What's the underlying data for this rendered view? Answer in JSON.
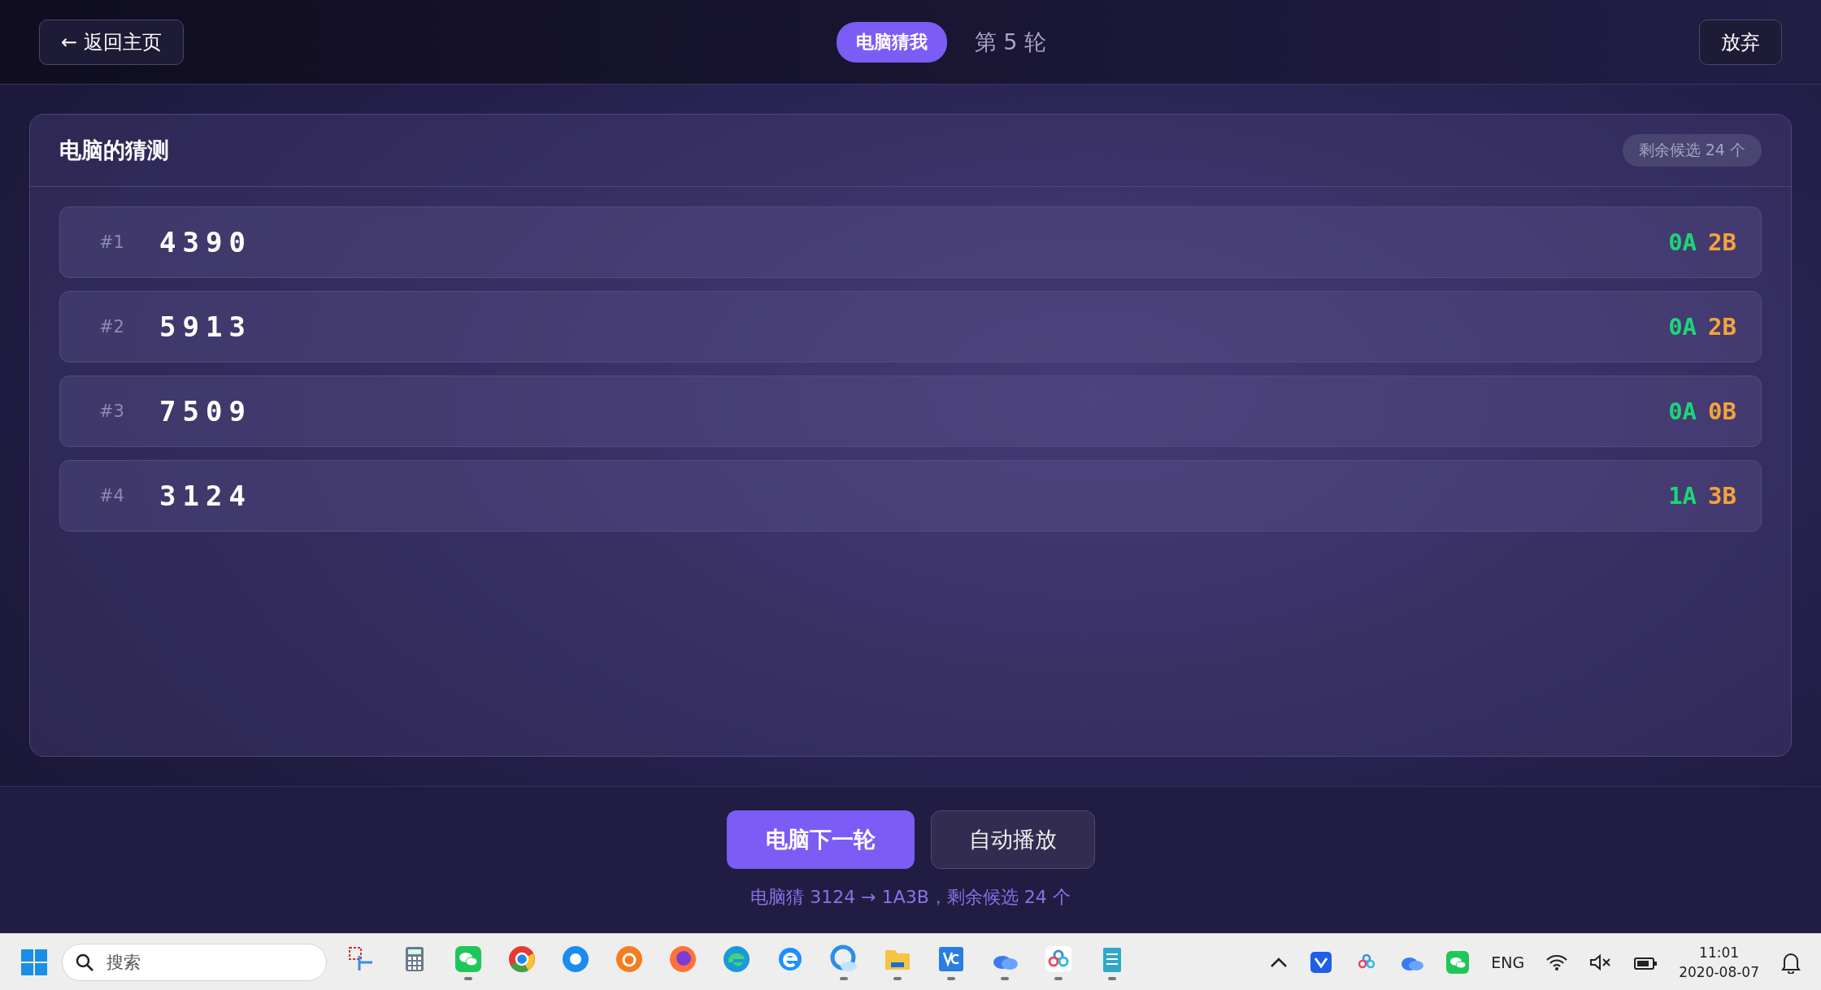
{
  "header": {
    "back_button": "← 返回主页",
    "mode_badge": "电脑猜我",
    "round": "第 5 轮",
    "quit_button": "放弃"
  },
  "panel": {
    "title": "电脑的猜测",
    "remaining_badge": "剩余候选 24 个",
    "guesses": [
      {
        "index": "#1",
        "number": "4390",
        "a": "0A",
        "b": "2B"
      },
      {
        "index": "#2",
        "number": "5913",
        "a": "0A",
        "b": "2B"
      },
      {
        "index": "#3",
        "number": "7509",
        "a": "0A",
        "b": "0B"
      },
      {
        "index": "#4",
        "number": "3124",
        "a": "1A",
        "b": "3B"
      }
    ]
  },
  "actions": {
    "buttons": [
      {
        "label": "电脑下一轮",
        "kind": "primary"
      },
      {
        "label": "自动播放",
        "kind": "secondary"
      }
    ],
    "status": "电脑猜 3124 → 1A3B，剩余候选 24 个"
  },
  "taskbar": {
    "search_placeholder": "搜索",
    "apps": [
      {
        "kind": "snip",
        "running": false
      },
      {
        "kind": "calculator",
        "running": false
      },
      {
        "kind": "chat",
        "running": true
      },
      {
        "kind": "chrome",
        "running": false
      },
      {
        "kind": "ring",
        "running": false
      },
      {
        "kind": "orange",
        "running": false
      },
      {
        "kind": "firefox",
        "running": false
      },
      {
        "kind": "edge",
        "running": false
      },
      {
        "kind": "ie",
        "running": false
      },
      {
        "kind": "cloudring",
        "running": true
      },
      {
        "kind": "folder",
        "running": true
      },
      {
        "kind": "vc",
        "running": true
      },
      {
        "kind": "cloud",
        "running": true
      },
      {
        "kind": "rings",
        "running": true
      },
      {
        "kind": "notepad",
        "running": true
      }
    ],
    "tray": {
      "language": "ENG",
      "time": "11:01",
      "date": "2020-08-07"
    }
  }
}
